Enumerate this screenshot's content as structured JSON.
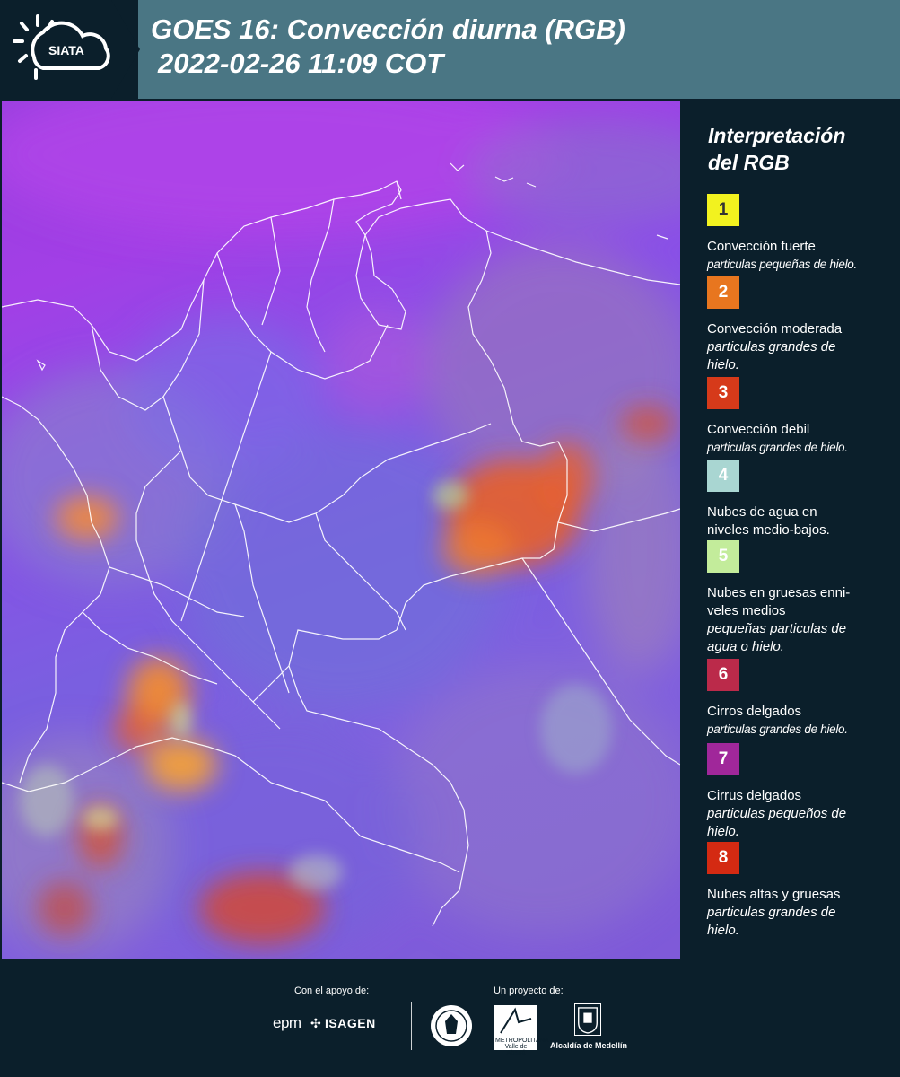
{
  "header": {
    "logo_text": "SIATA",
    "title": "GOES 16: Convección diurna (RGB)",
    "subtitle": "2022-02-26 11:09 COT"
  },
  "legend": {
    "title_line1": "Interpretación",
    "title_line2": "del RGB",
    "items": [
      {
        "number": "1",
        "color": "#f2f21f",
        "number_color": "#333333",
        "label": "Convección fuerte",
        "sub": "particulas pequeñas de hielo."
      },
      {
        "number": "2",
        "color": "#e8761f",
        "number_color": "#ffffff",
        "label": "Convección moderada",
        "sub": "particulas grandes de hielo."
      },
      {
        "number": "3",
        "color": "#d63a1a",
        "number_color": "#ffffff",
        "label": "Convección debil",
        "sub": "particulas grandes de hielo."
      },
      {
        "number": "4",
        "color": "#a9d6d2",
        "number_color": "#ffffff",
        "label": "Nubes de agua en niveles medio-bajos.",
        "sub": ""
      },
      {
        "number": "5",
        "color": "#c3ec9b",
        "number_color": "#ffffff",
        "label": "Nubes en gruesas enni-veles medios",
        "sub": "pequeñas particulas de agua o hielo."
      },
      {
        "number": "6",
        "color": "#bb2a4a",
        "number_color": "#ffffff",
        "label": "Cirros delgados",
        "sub": "particulas grandes de hielo."
      },
      {
        "number": "7",
        "color": "#a0279a",
        "number_color": "#ffffff",
        "label": "Cirrus delgados",
        "sub": "particulas pequeños de hielo."
      },
      {
        "number": "8",
        "color": "#d42a12",
        "number_color": "#ffffff",
        "label": "Nubes altas y gruesas",
        "sub": "particulas grandes de hielo."
      }
    ]
  },
  "footer": {
    "support_label": "Con el apoyo de:",
    "project_label": "Un proyecto de:",
    "epm": "epm",
    "isagen": "ISAGEN",
    "area_text": "METROPOLITANA Valle de Aburrá",
    "alcaldia": "Alcaldía de Medellín"
  }
}
